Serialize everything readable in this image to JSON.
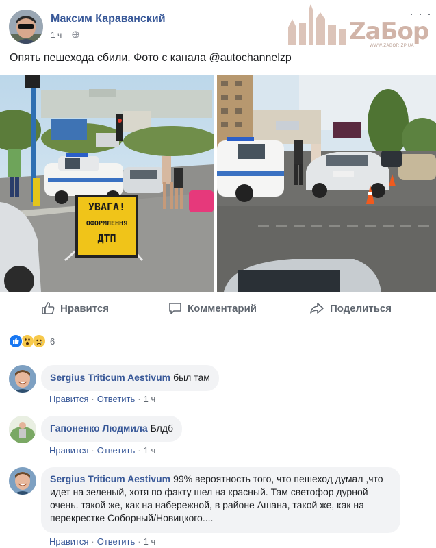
{
  "post": {
    "author": "Максим Караванский",
    "time": "1 ч",
    "text": "Опять пешехода сбили. Фото с канала @autochannelzp"
  },
  "watermark": {
    "text": "ZaБор",
    "url": "WWW.ZABOR.ZP.UA"
  },
  "photo_left": {
    "sign_line1": "УВАГА!",
    "sign_line2": "ОФОРМЛЕННЯ",
    "sign_line3": "ДТП"
  },
  "actions": {
    "like": "Нравится",
    "comment": "Комментарий",
    "share": "Поделиться"
  },
  "reactions": {
    "count": "6",
    "types": [
      "like-icon",
      "wow-icon",
      "sad-icon"
    ]
  },
  "comments": [
    {
      "author": "Sergius Triticum Aestivum",
      "text": "был там",
      "like": "Нравится",
      "reply": "Ответить",
      "time": "1 ч"
    },
    {
      "author": "Гапоненко Людмила",
      "text": "Блдб",
      "like": "Нравится",
      "reply": "Ответить",
      "time": "1 ч"
    },
    {
      "author": "Sergius Triticum Aestivum",
      "text": "99% вероятность того, что пешеход думал ,что идет на зеленый, хотя по факту шел на красный. Там светофор дурной очень. такой же, как на набережной, в районе Ашана, такой же, как на перекрестке Соборный/Новицкого....",
      "like": "Нравится",
      "reply": "Ответить",
      "time": "1 ч"
    }
  ],
  "colors": {
    "link": "#385898",
    "secondary": "#606770",
    "bubble": "#f2f3f5"
  }
}
